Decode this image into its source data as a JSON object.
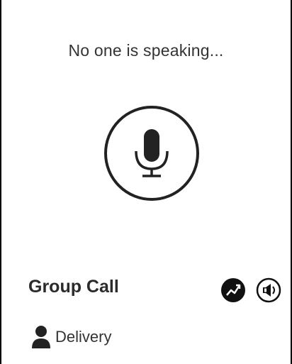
{
  "status": {
    "text": "No one is speaking..."
  },
  "mic": {
    "icon": "microphone-icon"
  },
  "footer": {
    "title": "Group Call",
    "icons": [
      "trend-icon",
      "speaker-icon"
    ],
    "group": {
      "icon": "person-icon",
      "name": "Delivery"
    }
  },
  "colors": {
    "background": "#ffffff",
    "text": "#333333",
    "icon": "#222222"
  }
}
